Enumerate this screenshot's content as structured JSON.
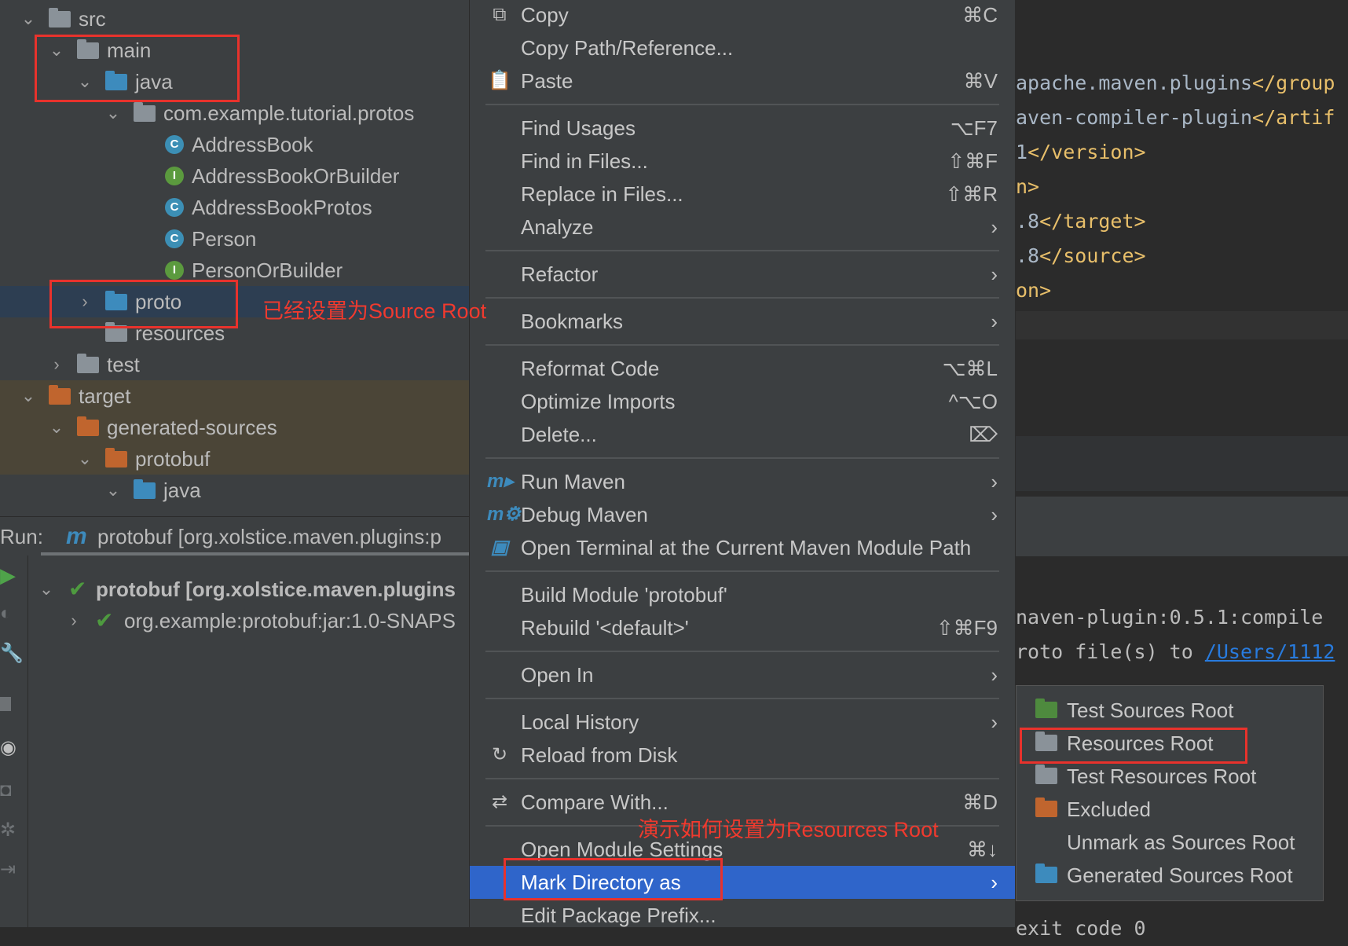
{
  "project_tree": [
    {
      "label": "src",
      "indent": 0,
      "chevron": "down",
      "icon": "folder",
      "color": "#8a9299"
    },
    {
      "label": "main",
      "indent": 1,
      "chevron": "down",
      "icon": "folder",
      "color": "#8a9299"
    },
    {
      "label": "java",
      "indent": 2,
      "chevron": "down",
      "icon": "folder",
      "color": "#3d8bbd"
    },
    {
      "label": "com.example.tutorial.protos",
      "indent": 3,
      "chevron": "down",
      "icon": "package",
      "color": "#8a9299"
    },
    {
      "label": "AddressBook",
      "indent": 4,
      "icon": "class",
      "color": "#3c8fb5",
      "glyph": "C"
    },
    {
      "label": "AddressBookOrBuilder",
      "indent": 4,
      "icon": "interface",
      "color": "#5b9a3e",
      "glyph": "I"
    },
    {
      "label": "AddressBookProtos",
      "indent": 4,
      "icon": "class",
      "color": "#3c8fb5",
      "glyph": "C"
    },
    {
      "label": "Person",
      "indent": 4,
      "icon": "class",
      "color": "#3c8fb5",
      "glyph": "C"
    },
    {
      "label": "PersonOrBuilder",
      "indent": 4,
      "icon": "interface",
      "color": "#5b9a3e",
      "glyph": "I"
    },
    {
      "label": "proto",
      "indent": 2,
      "chevron": "right",
      "icon": "folder",
      "color": "#3d8bbd",
      "selected": true
    },
    {
      "label": "resources",
      "indent": 2,
      "icon": "resources-folder",
      "color": "#8a9299"
    },
    {
      "label": "test",
      "indent": 1,
      "chevron": "right",
      "icon": "folder",
      "color": "#8a9299"
    },
    {
      "label": "target",
      "indent": 0,
      "chevron": "down",
      "icon": "folder",
      "color": "#c0652e",
      "excluded": true
    },
    {
      "label": "generated-sources",
      "indent": 1,
      "chevron": "down",
      "icon": "folder",
      "color": "#c0652e",
      "excluded": true
    },
    {
      "label": "protobuf",
      "indent": 2,
      "chevron": "down",
      "icon": "folder",
      "color": "#c0652e",
      "excluded": true
    },
    {
      "label": "java",
      "indent": 3,
      "chevron": "down",
      "icon": "generated-folder",
      "color": "#3d8bbd"
    }
  ],
  "run": {
    "label": "Run:",
    "tab": "protobuf [org.xolstice.maven.plugins:p",
    "items": [
      {
        "label": "protobuf [org.xolstice.maven.plugins",
        "bold": true
      },
      {
        "label": "org.example:protobuf:jar:1.0-SNAPS",
        "bold": false
      }
    ]
  },
  "editor": {
    "code_lines": [
      {
        "text": "apache.maven.plugins",
        "tag": "</group"
      },
      {
        "text": "aven-compiler-plugin",
        "tag": "</artif"
      },
      {
        "text": "1",
        "tag": "</version>"
      },
      {
        "text": "",
        "tag": "n>"
      },
      {
        "text": ".8",
        "tag": "</target>"
      },
      {
        "text": ".8",
        "tag": "</source>"
      },
      {
        "text": "",
        "tag": "on>"
      }
    ],
    "console_lines": [
      {
        "text": "naven-plugin:0.5.1:compile",
        "link": ""
      },
      {
        "text": "roto file(s) to ",
        "link": "/Users/1112"
      },
      {
        "text": "exit code 0",
        "link": ""
      }
    ]
  },
  "context_menu": [
    {
      "label": "Copy",
      "shortcut": "⌘C",
      "icon": "copy-icon",
      "glyph": "⧉"
    },
    {
      "label": "Copy Path/Reference...",
      "shortcut": ""
    },
    {
      "label": "Paste",
      "shortcut": "⌘V",
      "icon": "paste-icon",
      "glyph": "📋"
    },
    {
      "sep": true
    },
    {
      "label": "Find Usages",
      "shortcut": "⌥F7"
    },
    {
      "label": "Find in Files...",
      "shortcut": "⇧⌘F"
    },
    {
      "label": "Replace in Files...",
      "shortcut": "⇧⌘R"
    },
    {
      "label": "Analyze",
      "shortcut": "›"
    },
    {
      "sep": true
    },
    {
      "label": "Refactor",
      "shortcut": "›"
    },
    {
      "sep": true
    },
    {
      "label": "Bookmarks",
      "shortcut": "›"
    },
    {
      "sep": true
    },
    {
      "label": "Reformat Code",
      "shortcut": "⌥⌘L"
    },
    {
      "label": "Optimize Imports",
      "shortcut": "^⌥O"
    },
    {
      "label": "Delete...",
      "shortcut": "⌦"
    },
    {
      "sep": true
    },
    {
      "label": "Run Maven",
      "shortcut": "›",
      "icon": "run-maven-icon",
      "glyph": "m▸"
    },
    {
      "label": "Debug Maven",
      "shortcut": "›",
      "icon": "debug-maven-icon",
      "glyph": "m⚙"
    },
    {
      "label": "Open Terminal at the Current Maven Module Path",
      "shortcut": "",
      "icon": "terminal-maven-icon",
      "glyph": "▣"
    },
    {
      "sep": true
    },
    {
      "label": "Build Module 'protobuf'",
      "shortcut": ""
    },
    {
      "label": "Rebuild '<default>'",
      "shortcut": "⇧⌘F9"
    },
    {
      "sep": true
    },
    {
      "label": "Open In",
      "shortcut": "›"
    },
    {
      "sep": true
    },
    {
      "label": "Local History",
      "shortcut": "›"
    },
    {
      "label": "Reload from Disk",
      "shortcut": "",
      "icon": "reload-icon",
      "glyph": "↻"
    },
    {
      "sep": true
    },
    {
      "label": "Compare With...",
      "shortcut": "⌘D",
      "icon": "compare-icon",
      "glyph": "⇄"
    },
    {
      "sep": true
    },
    {
      "label": "Open Module Settings",
      "shortcut": "⌘↓"
    },
    {
      "label": "Mark Directory as",
      "shortcut": "›",
      "highlighted": true
    },
    {
      "label": "Edit Package Prefix...",
      "shortcut": ""
    }
  ],
  "submenu": [
    {
      "label": "Test Sources Root",
      "icon": "test-sources-folder",
      "color": "#4e8a3e"
    },
    {
      "label": "Resources Root",
      "icon": "resources-folder",
      "color": "#8a9299"
    },
    {
      "label": "Test Resources Root",
      "icon": "test-resources-folder",
      "color": "#8a9299"
    },
    {
      "label": "Excluded",
      "icon": "excluded-folder",
      "color": "#c0652e"
    },
    {
      "label": "Unmark as Sources Root",
      "icon": ""
    },
    {
      "label": "Generated Sources Root",
      "icon": "generated-folder",
      "color": "#3d8bbd"
    }
  ],
  "annotations": {
    "source_root_note": "已经设置为Source Root",
    "resources_root_note": "演示如何设置为Resources Root",
    "color": "#e8322c"
  },
  "colors": {
    "selection": "#2f65ca",
    "tree_selected": "#2d3e52",
    "excluded_bg": "#4b4537",
    "accent_check": "#4e9a3f"
  }
}
